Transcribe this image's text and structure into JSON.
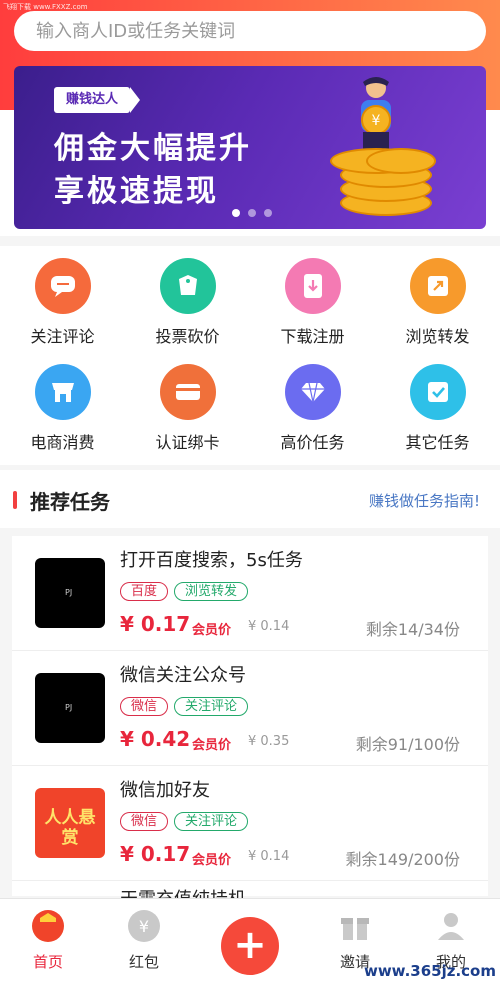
{
  "watermark_top": "飞翔下载 www.FXXZ.com",
  "search": {
    "placeholder": "输入商人ID或任务关键词"
  },
  "banner": {
    "tag": "赚钱达人",
    "line1": "佣金大幅提升",
    "line2": "享极速提现",
    "dots": 3,
    "active_dot": 1
  },
  "categories": [
    {
      "label": "关注评论",
      "color": "#f56a3c",
      "icon": "chat-icon"
    },
    {
      "label": "投票砍价",
      "color": "#22c49a",
      "icon": "tag-icon"
    },
    {
      "label": "下载注册",
      "color": "#f47ab3",
      "icon": "download-icon"
    },
    {
      "label": "浏览转发",
      "color": "#f79a2c",
      "icon": "share-icon"
    },
    {
      "label": "电商消费",
      "color": "#3aa6f2",
      "icon": "shop-icon"
    },
    {
      "label": "认证绑卡",
      "color": "#f0703a",
      "icon": "card-icon"
    },
    {
      "label": "高价任务",
      "color": "#6b6cf0",
      "icon": "diamond-icon"
    },
    {
      "label": "其它任务",
      "color": "#2ec0e8",
      "icon": "check-icon"
    }
  ],
  "recommend": {
    "title": "推荐任务",
    "guide": "赚钱做任务指南!"
  },
  "tasks": [
    {
      "title": "打开百度搜索，5s任务",
      "tag1": "百度",
      "tag2": "浏览转发",
      "price": "¥ 0.17",
      "vip": "会员价",
      "orig": "¥ 0.14",
      "remain": "剩余14/34份",
      "thumb": "dark",
      "thumb_mark": "PJ"
    },
    {
      "title": "微信关注公众号",
      "tag1": "微信",
      "tag2": "关注评论",
      "price": "¥ 0.42",
      "vip": "会员价",
      "orig": "¥ 0.35",
      "remain": "剩余91/100份",
      "thumb": "dark",
      "thumb_mark": "PJ"
    },
    {
      "title": "微信加好友",
      "tag1": "微信",
      "tag2": "关注评论",
      "price": "¥ 0.17",
      "vip": "会员价",
      "orig": "¥ 0.14",
      "remain": "剩余149/200份",
      "thumb": "red",
      "thumb_text": "人人悬赏"
    },
    {
      "title": "天需充值纯挂机",
      "partial": true
    }
  ],
  "nav": {
    "home": "首页",
    "redpacket": "红包",
    "invite": "邀请",
    "me": "我的",
    "home_badge": "人人悬赏"
  },
  "watermark_bottom": "www.365jz.com"
}
